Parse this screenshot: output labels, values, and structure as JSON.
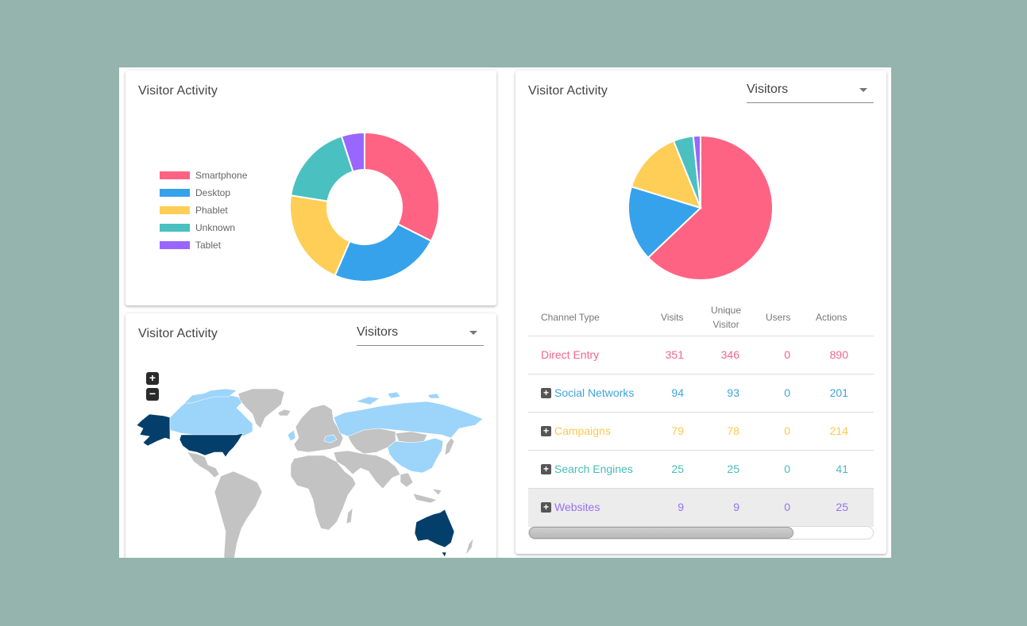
{
  "colors": {
    "pink": "#FF6384",
    "blue": "#36A2EB",
    "yellow": "#FFCE56",
    "teal": "#4BC0C0",
    "purple": "#9966FF",
    "map_high": "#043F6B",
    "map_mid": "#9DD4FA",
    "map_none": "#C3C3C3"
  },
  "devices_card": {
    "title": "Visitor Activity"
  },
  "map_card": {
    "title": "Visitor Activity",
    "metric_select": {
      "value": "Visitors"
    },
    "zoom_in_label": "+",
    "zoom_out_label": "−",
    "highlighted_high": [
      "United States",
      "Australia"
    ],
    "highlighted_mid": [
      "Canada",
      "Russia",
      "China",
      "United Kingdom",
      "Romania"
    ]
  },
  "channels_card": {
    "title": "Visitor Activity",
    "metric_select": {
      "value": "Visitors"
    },
    "table": {
      "columns": [
        "Channel Type",
        "Visits",
        "Unique Visitor",
        "Users",
        "Actions"
      ],
      "column_header_lines": {
        "unique_1": "Unique",
        "unique_2": "Visitor"
      },
      "rows": [
        {
          "name": "Direct Entry",
          "expandable": false,
          "visits": "351",
          "unique": "346",
          "users": "0",
          "actions": "890",
          "color": "#F2668B"
        },
        {
          "name": "Social Networks",
          "expandable": true,
          "visits": "94",
          "unique": "93",
          "users": "0",
          "actions": "201",
          "color": "#3FA4DB"
        },
        {
          "name": "Campaigns",
          "expandable": true,
          "visits": "79",
          "unique": "78",
          "users": "0",
          "actions": "214",
          "color": "#FCC84F"
        },
        {
          "name": "Search Engines",
          "expandable": true,
          "visits": "25",
          "unique": "25",
          "users": "0",
          "actions": "41",
          "color": "#45BDB8"
        },
        {
          "name": "Websites",
          "expandable": true,
          "visits": "9",
          "unique": "9",
          "users": "0",
          "actions": "25",
          "color": "#9A70F0"
        }
      ]
    },
    "horizontal_scroll_position": 0.0,
    "horizontal_scroll_visible_fraction": 0.77
  },
  "chart_data": [
    {
      "type": "pie",
      "variant": "doughnut",
      "title": "Visitor Activity",
      "legend_position": "left",
      "categories": [
        "Smartphone",
        "Desktop",
        "Phablet",
        "Unknown",
        "Tablet"
      ],
      "values": [
        32.5,
        24,
        21,
        17.5,
        5
      ],
      "value_units": "percent (estimated)",
      "colors": [
        "#FF6384",
        "#36A2EB",
        "#FFCE56",
        "#4BC0C0",
        "#9966FF"
      ]
    },
    {
      "type": "pie",
      "title": "Visitor Activity",
      "legend_position": "none",
      "categories": [
        "Direct Entry",
        "Social Networks",
        "Campaigns",
        "Search Engines",
        "Websites"
      ],
      "values": [
        351,
        94,
        79,
        25,
        9
      ],
      "colors": [
        "#FF6384",
        "#36A2EB",
        "#FFCE56",
        "#4BC0C0",
        "#9966FF"
      ]
    }
  ]
}
